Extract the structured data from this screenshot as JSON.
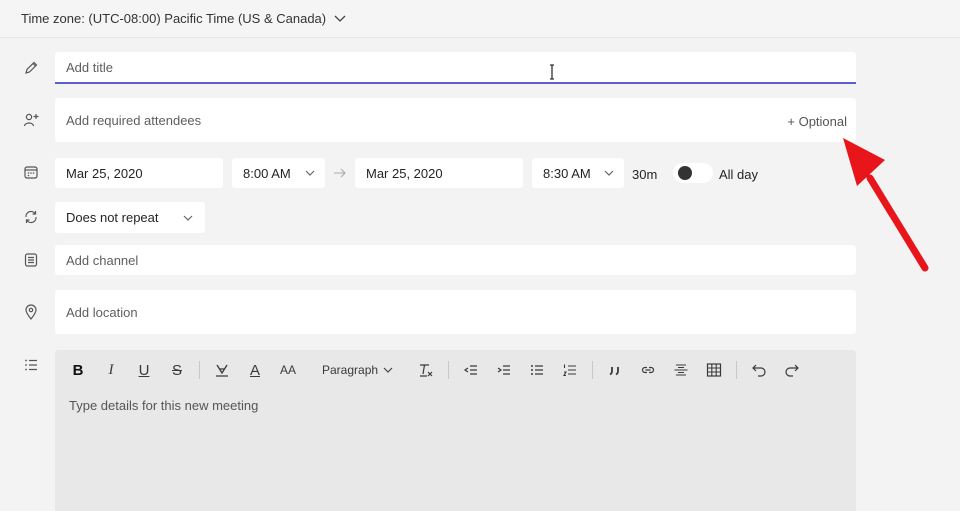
{
  "timezone": {
    "label": "Time zone: (UTC-08:00) Pacific Time (US & Canada)"
  },
  "title_field": {
    "placeholder": "Add title"
  },
  "attendees": {
    "placeholder": "Add required attendees",
    "optional_label": "+ Optional"
  },
  "schedule": {
    "start_date": "Mar 25, 2020",
    "start_time": "8:00 AM",
    "end_date": "Mar 25, 2020",
    "end_time": "8:30 AM",
    "duration": "30m",
    "all_day_label": "All day"
  },
  "repeat": {
    "value": "Does not repeat"
  },
  "channel": {
    "placeholder": "Add channel"
  },
  "location": {
    "placeholder": "Add location"
  },
  "editor": {
    "toolbar": {
      "bold": "B",
      "italic": "I",
      "underline": "U",
      "strike": "S",
      "font_color": "A",
      "font_size": "AA",
      "paragraph": "Paragraph"
    },
    "placeholder": "Type details for this new meeting"
  },
  "colors": {
    "accent": "#5b5fc7",
    "annotation_arrow": "#e8151b"
  }
}
